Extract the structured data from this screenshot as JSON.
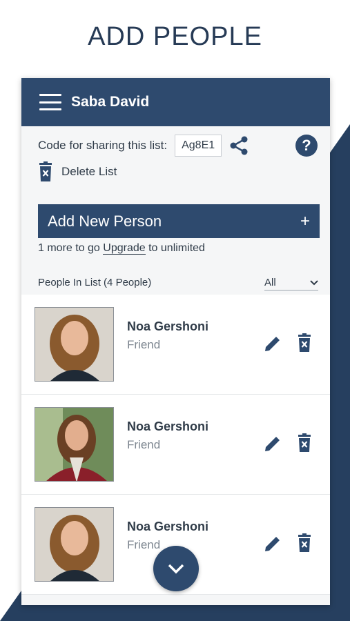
{
  "heading": "ADD PEOPLE",
  "colors": {
    "primary": "#2e4a6e",
    "background_panel": "#263f5f",
    "text": "#2f3b48",
    "muted": "#7d8690"
  },
  "appbar": {
    "title": "Saba David",
    "menu_icon": "hamburger-menu-icon"
  },
  "sharing": {
    "label": "Code for sharing this list:",
    "code": "Ag8E1",
    "share_icon": "share-icon",
    "help_icon": "help-icon",
    "help_glyph": "?"
  },
  "delete_list": {
    "label": "Delete List",
    "icon": "trash-icon"
  },
  "add_person": {
    "label": "Add New Person",
    "plus": "+"
  },
  "upgrade": {
    "prefix": "1 more to go",
    "link": "Upgrade",
    "suffix": "to unlimited"
  },
  "people": {
    "header": "People In List (4 People)",
    "filter": {
      "selected": "All",
      "icon": "chevron-down-icon"
    },
    "items": [
      {
        "name": "Noa Gershoni",
        "relation": "Friend"
      },
      {
        "name": "Noa Gershoni",
        "relation": "Friend"
      },
      {
        "name": "Noa Gershoni",
        "relation": "Friend"
      }
    ]
  },
  "fab": {
    "icon": "chevron-down-icon"
  }
}
